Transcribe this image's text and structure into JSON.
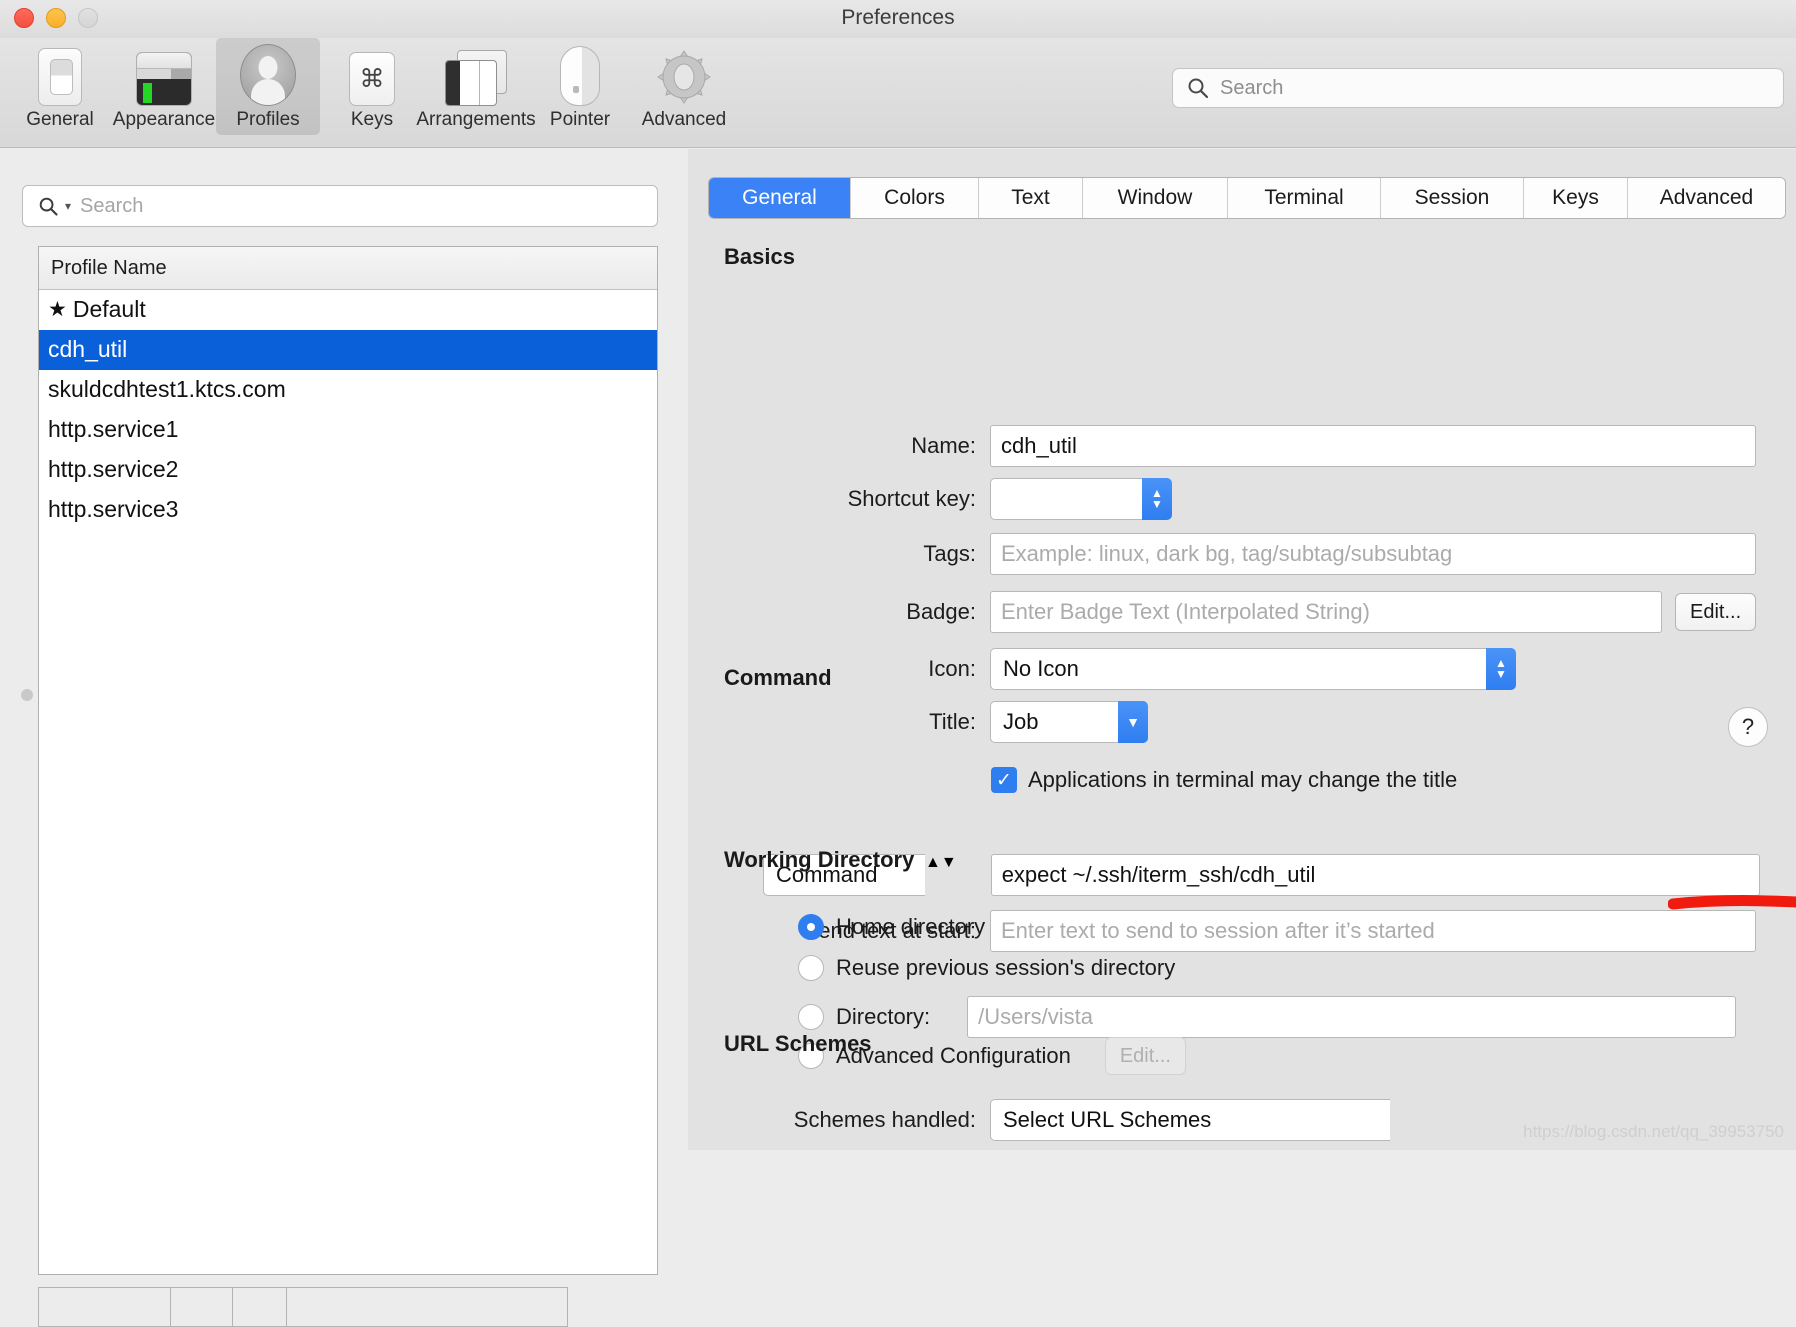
{
  "window": {
    "title": "Preferences",
    "controls": [
      "close",
      "minimize",
      "zoom"
    ]
  },
  "toolbar": {
    "items": [
      {
        "label": "General",
        "icon": "general-icon",
        "selected": false
      },
      {
        "label": "Appearance",
        "icon": "appearance-icon",
        "selected": false
      },
      {
        "label": "Profiles",
        "icon": "profiles-icon",
        "selected": true
      },
      {
        "label": "Keys",
        "icon": "keys-icon",
        "selected": false
      },
      {
        "label": "Arrangements",
        "icon": "arrangements-icon",
        "selected": false
      },
      {
        "label": "Pointer",
        "icon": "pointer-icon",
        "selected": false
      },
      {
        "label": "Advanced",
        "icon": "advanced-icon",
        "selected": false
      }
    ],
    "search": {
      "placeholder": "Search",
      "value": "",
      "icon": "search-icon"
    }
  },
  "sidebar": {
    "search": {
      "placeholder": "Search",
      "value": "",
      "icon": "search-icon"
    },
    "column_header": "Profile Name",
    "profiles": [
      {
        "name": "Default",
        "is_default": true,
        "selected": false,
        "star": "★"
      },
      {
        "name": "cdh_util",
        "is_default": false,
        "selected": true,
        "star": ""
      },
      {
        "name": "skuldcdhtest1.ktcs.com",
        "is_default": false,
        "selected": false,
        "star": ""
      },
      {
        "name": "http.service1",
        "is_default": false,
        "selected": false,
        "star": ""
      },
      {
        "name": "http.service2",
        "is_default": false,
        "selected": false,
        "star": ""
      },
      {
        "name": "http.service3",
        "is_default": false,
        "selected": false,
        "star": ""
      }
    ]
  },
  "tabs": [
    {
      "label": "General",
      "active": true
    },
    {
      "label": "Colors",
      "active": false
    },
    {
      "label": "Text",
      "active": false
    },
    {
      "label": "Window",
      "active": false
    },
    {
      "label": "Terminal",
      "active": false
    },
    {
      "label": "Session",
      "active": false
    },
    {
      "label": "Keys",
      "active": false
    },
    {
      "label": "Advanced",
      "active": false
    }
  ],
  "basics": {
    "section_title": "Basics",
    "name": {
      "label": "Name:",
      "value": "cdh_util"
    },
    "shortcut_key": {
      "label": "Shortcut key:",
      "value": ""
    },
    "tags": {
      "label": "Tags:",
      "value": "",
      "placeholder": "Example: linux, dark bg, tag/subtag/subsubtag"
    },
    "badge": {
      "label": "Badge:",
      "value": "",
      "placeholder": "Enter Badge Text (Interpolated String)",
      "edit_label": "Edit..."
    },
    "icon": {
      "label": "Icon:",
      "value": "No Icon"
    },
    "title": {
      "label": "Title:",
      "value": "Job"
    },
    "apps_change_title": {
      "label": "Applications in terminal may change the title",
      "checked": true
    }
  },
  "command": {
    "section_title": "Command",
    "type": {
      "value": "Command"
    },
    "value": "expect ~/.ssh/iterm_ssh/cdh_util",
    "send_text": {
      "label": "Send text at start:",
      "value": "",
      "placeholder": "Enter text to send to session after it’s started"
    }
  },
  "working_directory": {
    "section_title": "Working Directory",
    "options": [
      {
        "label": "Home directory",
        "selected": true
      },
      {
        "label": "Reuse previous session's directory",
        "selected": false
      },
      {
        "label": "Directory:",
        "selected": false
      },
      {
        "label": "Advanced Configuration",
        "selected": false
      }
    ],
    "directory": {
      "value": "",
      "placeholder": "/Users/vista"
    },
    "advanced_edit_label": "Edit..."
  },
  "url_schemes": {
    "section_title": "URL Schemes",
    "row_label": "Schemes handled:",
    "value": "Select URL Schemes"
  },
  "help": {
    "glyph": "?"
  },
  "annotation": {
    "color": "#f01b0e",
    "target": "command-value-field"
  },
  "watermark": "https://blog.csdn.net/qq_39953750",
  "colors": {
    "accent": "#2f7ef0",
    "selection": "#0a60d8",
    "tab_active": "#3b82f6",
    "window_bg": "#ececec",
    "pane_bg": "#e2e2e2"
  }
}
